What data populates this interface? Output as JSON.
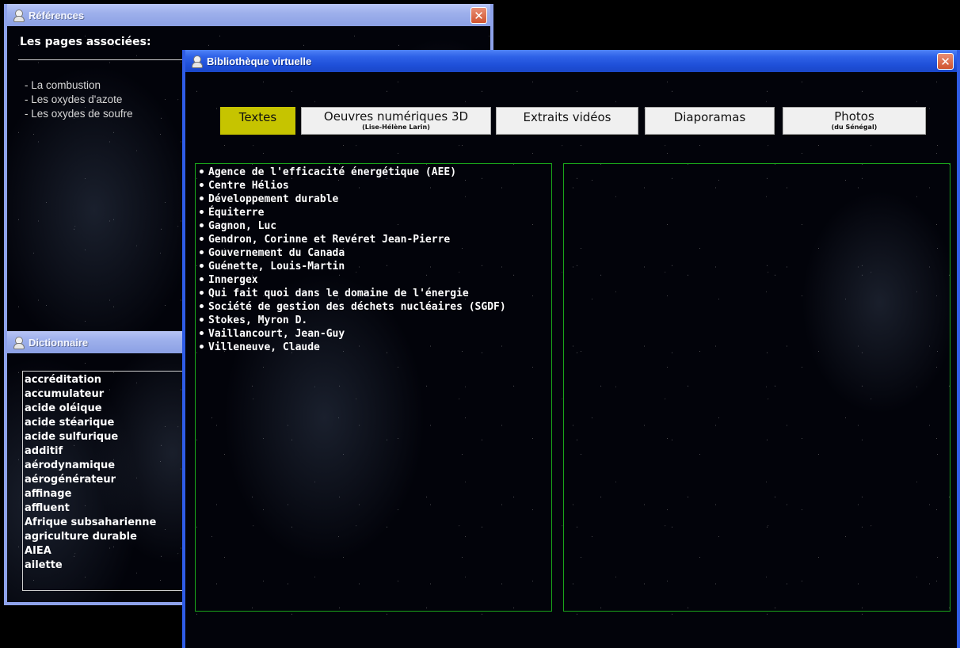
{
  "references": {
    "title": "Références",
    "close": "✕",
    "header": "Les pages associées:",
    "items": [
      "- La combustion",
      "- Les oxydes d'azote",
      "- Les oxydes de soufre"
    ]
  },
  "dictionary": {
    "title": "Dictionnaire",
    "items": [
      "accréditation",
      "accumulateur",
      "acide oléique",
      "acide stéarique",
      "acide sulfurique",
      "additif",
      "aérodynamique",
      "aérogénérateur",
      "affinage",
      "affluent",
      "Afrique subsaharienne",
      "agriculture durable",
      "AIEA",
      "ailette"
    ]
  },
  "library": {
    "title": "Bibliothèque virtuelle",
    "close": "✕",
    "tabs": [
      {
        "label": "Textes",
        "sub": ""
      },
      {
        "label": "Oeuvres numériques 3D",
        "sub": "(Lise-Hélène Larin)"
      },
      {
        "label": "Extraits vidéos",
        "sub": ""
      },
      {
        "label": "Diaporamas",
        "sub": ""
      },
      {
        "label": "Photos",
        "sub": "(du Sénégal)"
      }
    ],
    "texts": [
      "Agence de l'efficacité énergétique (AEE)",
      "Centre Hélios",
      "Développement durable",
      "Équiterre",
      "Gagnon, Luc",
      "Gendron, Corinne et Revéret Jean-Pierre",
      "Gouvernement du Canada",
      "Guénette, Louis-Martin",
      "Innergex",
      "Qui fait quoi dans le domaine de l'énergie",
      "Société de gestion des déchets nucléaires (SGDF)",
      "Stokes, Myron D.",
      "Vaillancourt, Jean-Guy",
      "Villeneuve, Claude"
    ]
  },
  "colors": {
    "selected_tab": "#c6c400",
    "panel_border": "#1aa61a",
    "active_titlebar": "#2f62e8"
  }
}
